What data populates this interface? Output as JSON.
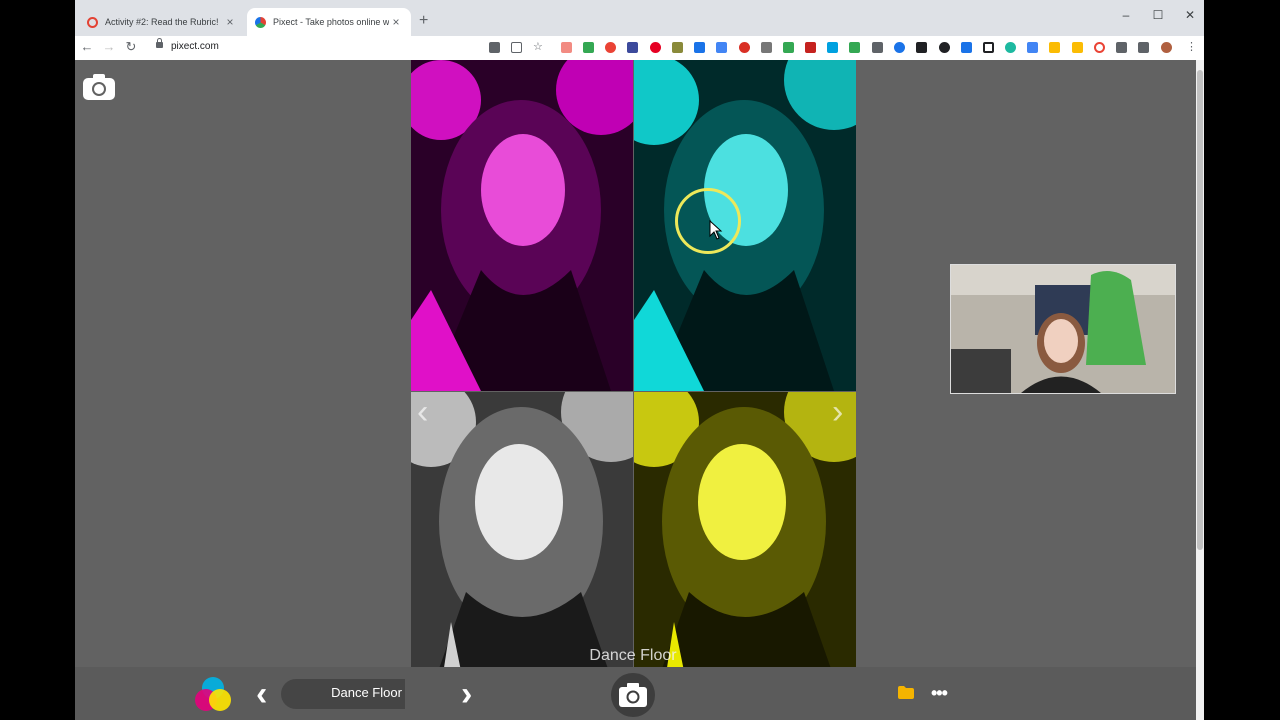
{
  "browser": {
    "tabs": [
      {
        "title": "Activity #2: Read the Rubric!",
        "favicon_color": "#e34234",
        "active": false
      },
      {
        "title": "Pixect - Take photos online with",
        "favicon_color": "#34a853",
        "active": true
      }
    ],
    "new_tab_symbol": "+",
    "close_symbol": "×",
    "window_controls": {
      "minimize": "–",
      "maximize": "☐",
      "close": "✕"
    },
    "url": "pixect.com",
    "nav": {
      "back": "←",
      "forward": "→",
      "reload": "↻"
    }
  },
  "page": {
    "background": "#626262",
    "photo_tints": [
      "#e010c8",
      "#10d8d8",
      "#888888",
      "#e8e800"
    ],
    "carousel_prev": "‹",
    "carousel_next": "›",
    "overlay_label": "Dance Floor",
    "bottom_bar": {
      "filter_prev": "‹",
      "filter_next": "›",
      "filter_name": "Dance Floor",
      "more_label": "•••"
    }
  },
  "icons": [
    "camera-icon",
    "pixect-logo-icon",
    "folder-icon",
    "more-icon",
    "shutter-camera-icon"
  ]
}
